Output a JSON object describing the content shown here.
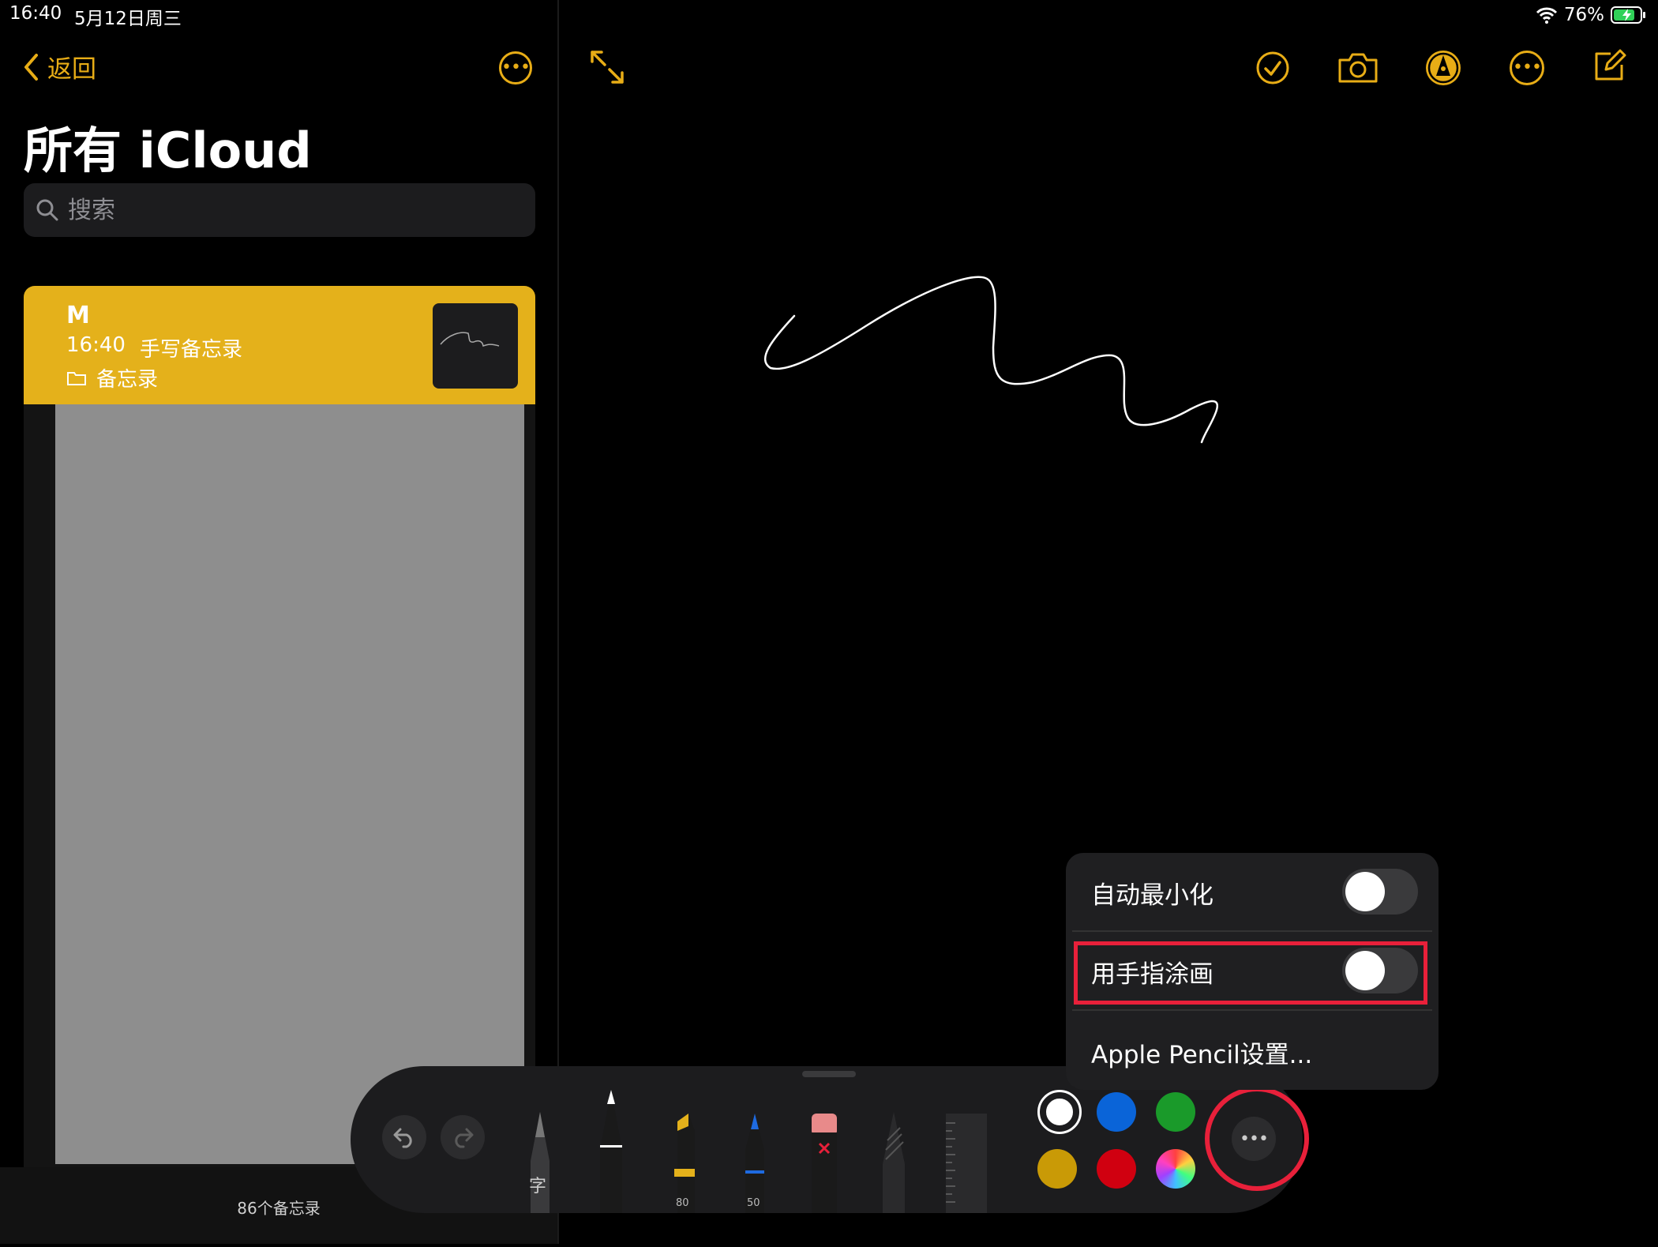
{
  "status": {
    "time": "16:40",
    "date": "5月12日周三",
    "battery": "76%"
  },
  "sidebar": {
    "back_label": "返回",
    "folder_title": "所有 iCloud",
    "search_placeholder": "搜索",
    "note": {
      "title": "M",
      "time": "16:40",
      "subtitle": "手写备忘录",
      "folder": "备忘录"
    },
    "note_count": "86个备忘录"
  },
  "popover": {
    "auto_minimize_label": "自动最小化",
    "auto_minimize_on": false,
    "finger_draw_label": "用手指涂画",
    "finger_draw_on": false,
    "pencil_settings_label": "Apple Pencil设置..."
  },
  "palette": {
    "text_tool_label": "字",
    "marker_width": "80",
    "pen_width": "50",
    "colors": [
      "#ffffff",
      "#0a64d8",
      "#1a9a2a",
      "#c99a06",
      "#d00010"
    ]
  },
  "colors": {
    "accent": "#e4b11b",
    "highlight": "#e8203a"
  }
}
